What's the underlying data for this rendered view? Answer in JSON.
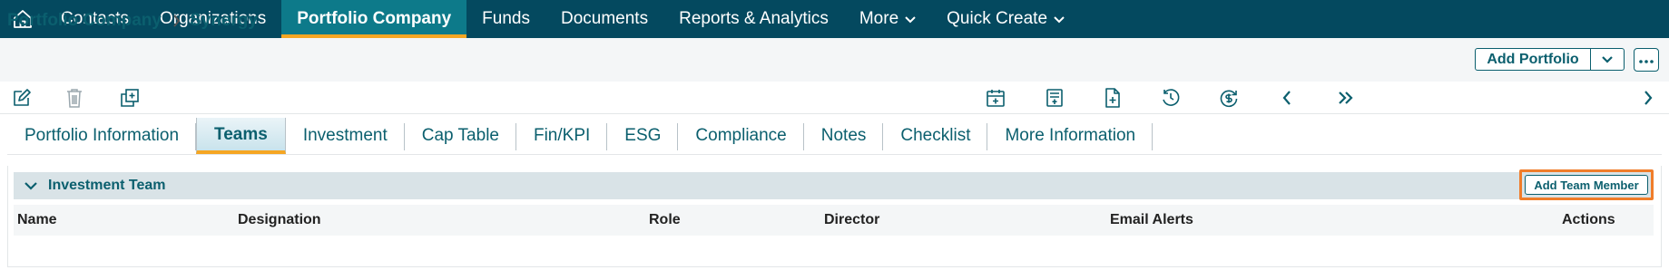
{
  "nav": {
    "home_icon": "home-icon",
    "items": [
      {
        "label": "Contacts"
      },
      {
        "label": "Organizations"
      },
      {
        "label": "Portfolio Company",
        "active": true
      },
      {
        "label": "Funds"
      },
      {
        "label": "Documents"
      },
      {
        "label": "Reports & Analytics"
      },
      {
        "label": "More",
        "dropdown": true
      },
      {
        "label": "Quick Create",
        "dropdown": true
      }
    ],
    "colors": {
      "background": "#04495f",
      "active": "#0d7a8a",
      "accent": "#f5a623"
    }
  },
  "breadcrumb": {
    "items": [
      "Portfolio Company",
      "Synergy"
    ]
  },
  "header_actions": {
    "add_portfolio_label": "Add Portfolio"
  },
  "toolbar": {
    "left_icons": [
      "edit-icon",
      "trash-icon",
      "duplicate-icon"
    ],
    "right_icons": [
      "calendar-add-icon",
      "form-icon",
      "document-add-icon",
      "history-icon",
      "currency-refresh-icon",
      "previous-icon",
      "double-next-icon",
      "next-icon"
    ]
  },
  "tabs": [
    {
      "label": "Portfolio Information"
    },
    {
      "label": "Teams",
      "active": true
    },
    {
      "label": "Investment"
    },
    {
      "label": "Cap Table"
    },
    {
      "label": "Fin/KPI"
    },
    {
      "label": "ESG"
    },
    {
      "label": "Compliance"
    },
    {
      "label": "Notes"
    },
    {
      "label": "Checklist"
    },
    {
      "label": "More Information"
    }
  ],
  "section": {
    "title": "Investment Team",
    "add_button_label": "Add Team Member",
    "columns": [
      "Name",
      "Designation",
      "Role",
      "Director",
      "Email Alerts",
      "Actions"
    ],
    "rows": []
  }
}
